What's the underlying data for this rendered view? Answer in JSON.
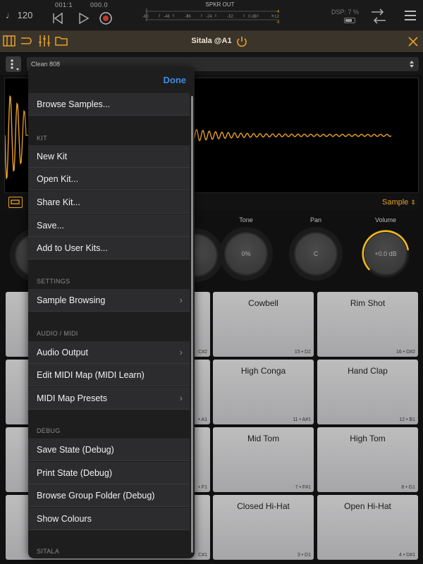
{
  "transport": {
    "tempo": "♩ 120",
    "bars_beats": "001:1",
    "time": "000.0",
    "meter_title": "SPKR OUT",
    "meter_scale": [
      "-60",
      "-48",
      "-36",
      "-24",
      "-12",
      "0 dB",
      "+12"
    ],
    "dsp": "DSP: 7 %"
  },
  "plugin": {
    "title": "Sitala @A1"
  },
  "preset": {
    "name": "Clean 808"
  },
  "waveform": {
    "mode_label": "Sample",
    "color": "#e8a02a"
  },
  "knobs": [
    {
      "label": "Tone",
      "value": "0%"
    },
    {
      "label": "Pan",
      "value": "C"
    },
    {
      "label": "Volume",
      "value": "+0.0 dB",
      "level": 0.8
    }
  ],
  "pads": [
    {
      "name": "",
      "note": "C#2"
    },
    {
      "name": "Cowbell",
      "note": "15 • D2"
    },
    {
      "name": "Rim Shot",
      "note": "16 • D#2"
    },
    {
      "name": "",
      "note": "• A1"
    },
    {
      "name": "High Conga",
      "note": "11 • A#1"
    },
    {
      "name": "Hand Clap",
      "note": "12 • B1"
    },
    {
      "name": "",
      "note": "• F1"
    },
    {
      "name": "Mid Tom",
      "note": "7 • F#1"
    },
    {
      "name": "High Tom",
      "note": "8 • G1"
    },
    {
      "name": "",
      "note": "C#1"
    },
    {
      "name": "Closed Hi-Hat",
      "note": "3 • D1"
    },
    {
      "name": "Open Hi-Hat",
      "note": "4 • D#1"
    }
  ],
  "menu": {
    "done_label": "Done",
    "browse_samples": "Browse Samples...",
    "sections": {
      "kit": "KIT",
      "settings": "SETTINGS",
      "audio_midi": "AUDIO / MIDI",
      "debug": "DEBUG",
      "sitala": "SITALA"
    },
    "kit_items": [
      "New Kit",
      "Open Kit...",
      "Share Kit...",
      "Save...",
      "Add to User Kits..."
    ],
    "settings_items": [
      "Sample Browsing"
    ],
    "audio_items": [
      "Audio Output",
      "Edit MIDI Map (MIDI Learn)",
      "MIDI Map Presets"
    ],
    "debug_items": [
      "Save State (Debug)",
      "Print State (Debug)",
      "Browse Group Folder (Debug)",
      "Show Colours"
    ],
    "chevron": "›"
  }
}
